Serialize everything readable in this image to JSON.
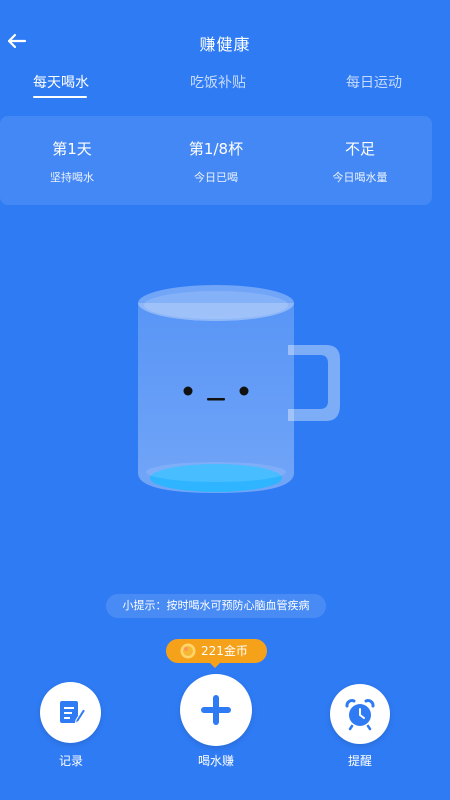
{
  "header": {
    "title": "赚健康"
  },
  "tabs": [
    {
      "label": "每天喝水",
      "active": true
    },
    {
      "label": "吃饭补贴",
      "active": false
    },
    {
      "label": "每日运动",
      "active": false
    }
  ],
  "stats": [
    {
      "value": "第1天",
      "label": "坚持喝水"
    },
    {
      "value": "第1/8杯",
      "label": "今日已喝"
    },
    {
      "value": "不足",
      "label": "今日喝水量"
    }
  ],
  "mug": {
    "fill_fraction": 0.125
  },
  "tip": "小提示：按时喝水可预防心脑血管疾病",
  "coin_badge": {
    "text": "221金币"
  },
  "actions": {
    "record": {
      "label": "记录",
      "icon": "edit-note-icon"
    },
    "drink": {
      "label": "喝水赚",
      "icon": "plus-icon"
    },
    "remind": {
      "label": "提醒",
      "icon": "alarm-clock-icon"
    }
  },
  "colors": {
    "background": "#2f7bf4",
    "accent_icon": "#2f7bf4",
    "coin": "#f5a21a",
    "water": "#2fb4ff"
  }
}
